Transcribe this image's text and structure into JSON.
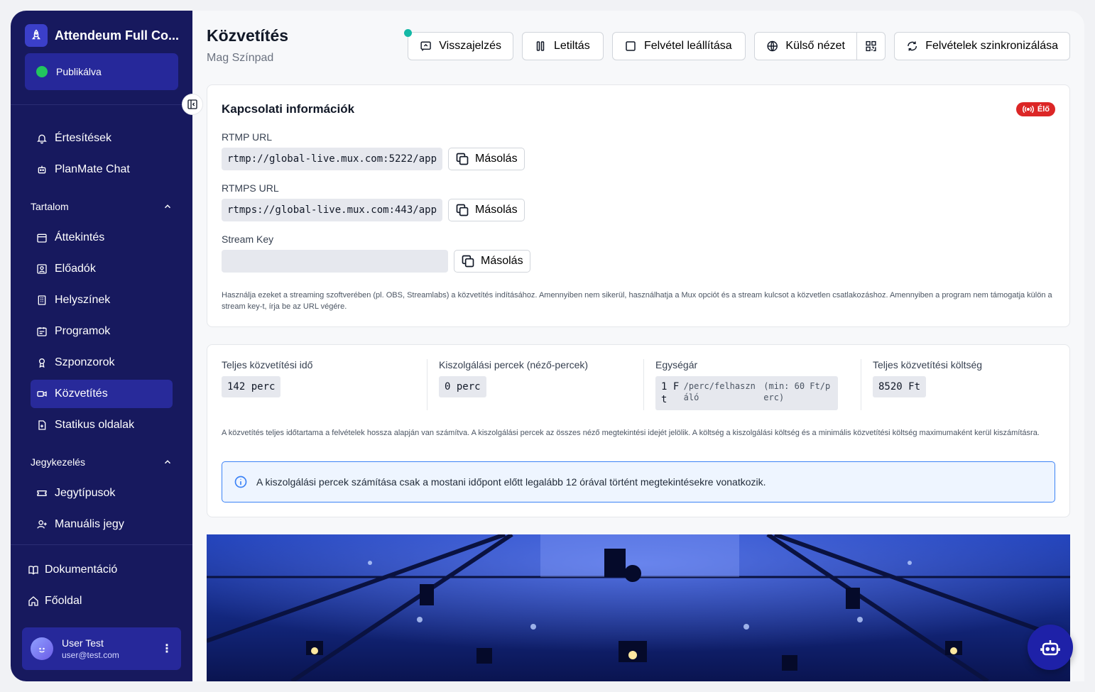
{
  "sidebar": {
    "app_title": "Attendeum Full Co...",
    "status_label": "Publikálva",
    "top_items": [
      {
        "label": "Értesítések",
        "icon": "bell-icon"
      },
      {
        "label": "PlanMate Chat",
        "icon": "bot-icon"
      }
    ],
    "section_content": "Tartalom",
    "content_items": [
      {
        "label": "Áttekintés",
        "icon": "calendar-icon"
      },
      {
        "label": "Előadók",
        "icon": "user-square-icon"
      },
      {
        "label": "Helyszínek",
        "icon": "building-icon"
      },
      {
        "label": "Programok",
        "icon": "calendar-list-icon"
      },
      {
        "label": "Szponzorok",
        "icon": "award-icon"
      },
      {
        "label": "Közvetítés",
        "icon": "video-icon",
        "active": true
      },
      {
        "label": "Statikus oldalak",
        "icon": "file-icon"
      }
    ],
    "section_ticketing": "Jegykezelés",
    "ticket_items": [
      {
        "label": "Jegytípusok",
        "icon": "ticket-icon"
      },
      {
        "label": "Manuális jegy",
        "icon": "user-plus-icon"
      }
    ],
    "bottom_items": [
      {
        "label": "Dokumentáció",
        "icon": "book-icon"
      },
      {
        "label": "Főoldal",
        "icon": "home-icon"
      }
    ],
    "user": {
      "name": "User Test",
      "email": "user@test.com"
    }
  },
  "header": {
    "title": "Közvetítés",
    "subtitle": "Mag Színpad",
    "buttons": {
      "feedback": "Visszajelzés",
      "disable": "Letiltás",
      "stop_recording": "Felvétel leállítása",
      "external_view": "Külső nézet",
      "sync_recordings": "Felvételek szinkronizálása"
    }
  },
  "connection": {
    "title": "Kapcsolati információk",
    "live_badge": "Élő",
    "rtmp_label": "RTMP URL",
    "rtmp_value": "rtmp://global-live.mux.com:5222/app",
    "rtmps_label": "RTMPS URL",
    "rtmps_value": "rtmps://global-live.mux.com:443/app",
    "key_label": "Stream Key",
    "key_value": "",
    "copy_label": "Másolás",
    "help": "Használja ezeket a streaming szoftverében (pl. OBS, Streamlabs) a közvetítés indításához. Amennyiben nem sikerül, használhatja a Mux opciót és a stream kulcsot a közvetlen csatlakozáshoz. Amennyiben a program nem támogatja külön a stream key-t, írja be az URL végére."
  },
  "stats": {
    "total_time_label": "Teljes közvetítési idő",
    "total_time_value": "142 perc",
    "serving_label": "Kiszolgálási percek (néző-percek)",
    "serving_value": "0 perc",
    "unit_price_label": "Egységár",
    "unit_price_amount": "1 Ft",
    "unit_price_unit": "/perc/felhasználó",
    "unit_price_min": "(min: 60 Ft/perc)",
    "total_cost_label": "Teljes közvetítési költség",
    "total_cost_value": "8520 Ft",
    "explanation": "A közvetítés teljes időtartama a felvételek hossza alapján van számítva. A kiszolgálási percek az összes néző megtekintési idejét jelölik. A költség a kiszolgálási költség és a minimális közvetítési költség maximumaként kerül kiszámításra.",
    "info_note": "A kiszolgálási percek számítása csak a mostani időpont előtt legalább 12 órával történt megtekintésekre vonatkozik."
  },
  "colors": {
    "sidebar_bg": "#17195e",
    "active_bg": "#282a9a",
    "live_red": "#dc2626",
    "info_blue": "#3b82f6",
    "status_green": "#22c55e"
  }
}
